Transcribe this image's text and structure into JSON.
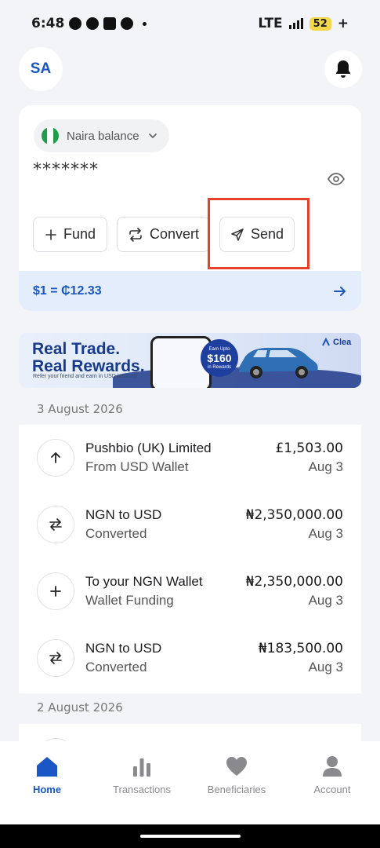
{
  "status_bar": {
    "time": "6:48",
    "network": "LTE",
    "battery": "52"
  },
  "header": {
    "avatar_initials": "SA"
  },
  "balance": {
    "currency_label": "Naira balance",
    "masked_value": "*******",
    "actions": {
      "fund": "Fund",
      "convert": "Convert",
      "send": "Send"
    },
    "rate": "$1 = ₵12.33"
  },
  "promo": {
    "line1": "Real Trade.",
    "line2": "Real Rewards.",
    "subtitle": "Refer your friend and earn in USD instantly",
    "badge_top": "Earn Upto",
    "badge_amount": "$160",
    "badge_bottom": "in Rewards",
    "brand": "Clea"
  },
  "transactions": {
    "group1_date": "3 August 2026",
    "items": [
      {
        "title": "Pushbio (UK) Limited",
        "subtitle": "From USD Wallet",
        "amount": "£1,503.00",
        "date": "Aug 3",
        "icon": "arrow-up-icon"
      },
      {
        "title": "NGN to USD",
        "subtitle": "Converted",
        "amount": "₦2,350,000.00",
        "date": "Aug 3",
        "icon": "swap-icon"
      },
      {
        "title": "To your NGN Wallet",
        "subtitle": "Wallet Funding",
        "amount": "₦2,350,000.00",
        "date": "Aug 3",
        "icon": "plus-icon"
      },
      {
        "title": "NGN to USD",
        "subtitle": "Converted",
        "amount": "₦183,500.00",
        "date": "Aug 3",
        "icon": "swap-icon"
      }
    ],
    "group2_date": "2 August 2026"
  },
  "nav": {
    "home": "Home",
    "transactions": "Transactions",
    "beneficiaries": "Beneficiaries",
    "account": "Account"
  },
  "colors": {
    "accent": "#1a56c4",
    "highlight": "#e8412a",
    "background": "#f2f4f7"
  }
}
